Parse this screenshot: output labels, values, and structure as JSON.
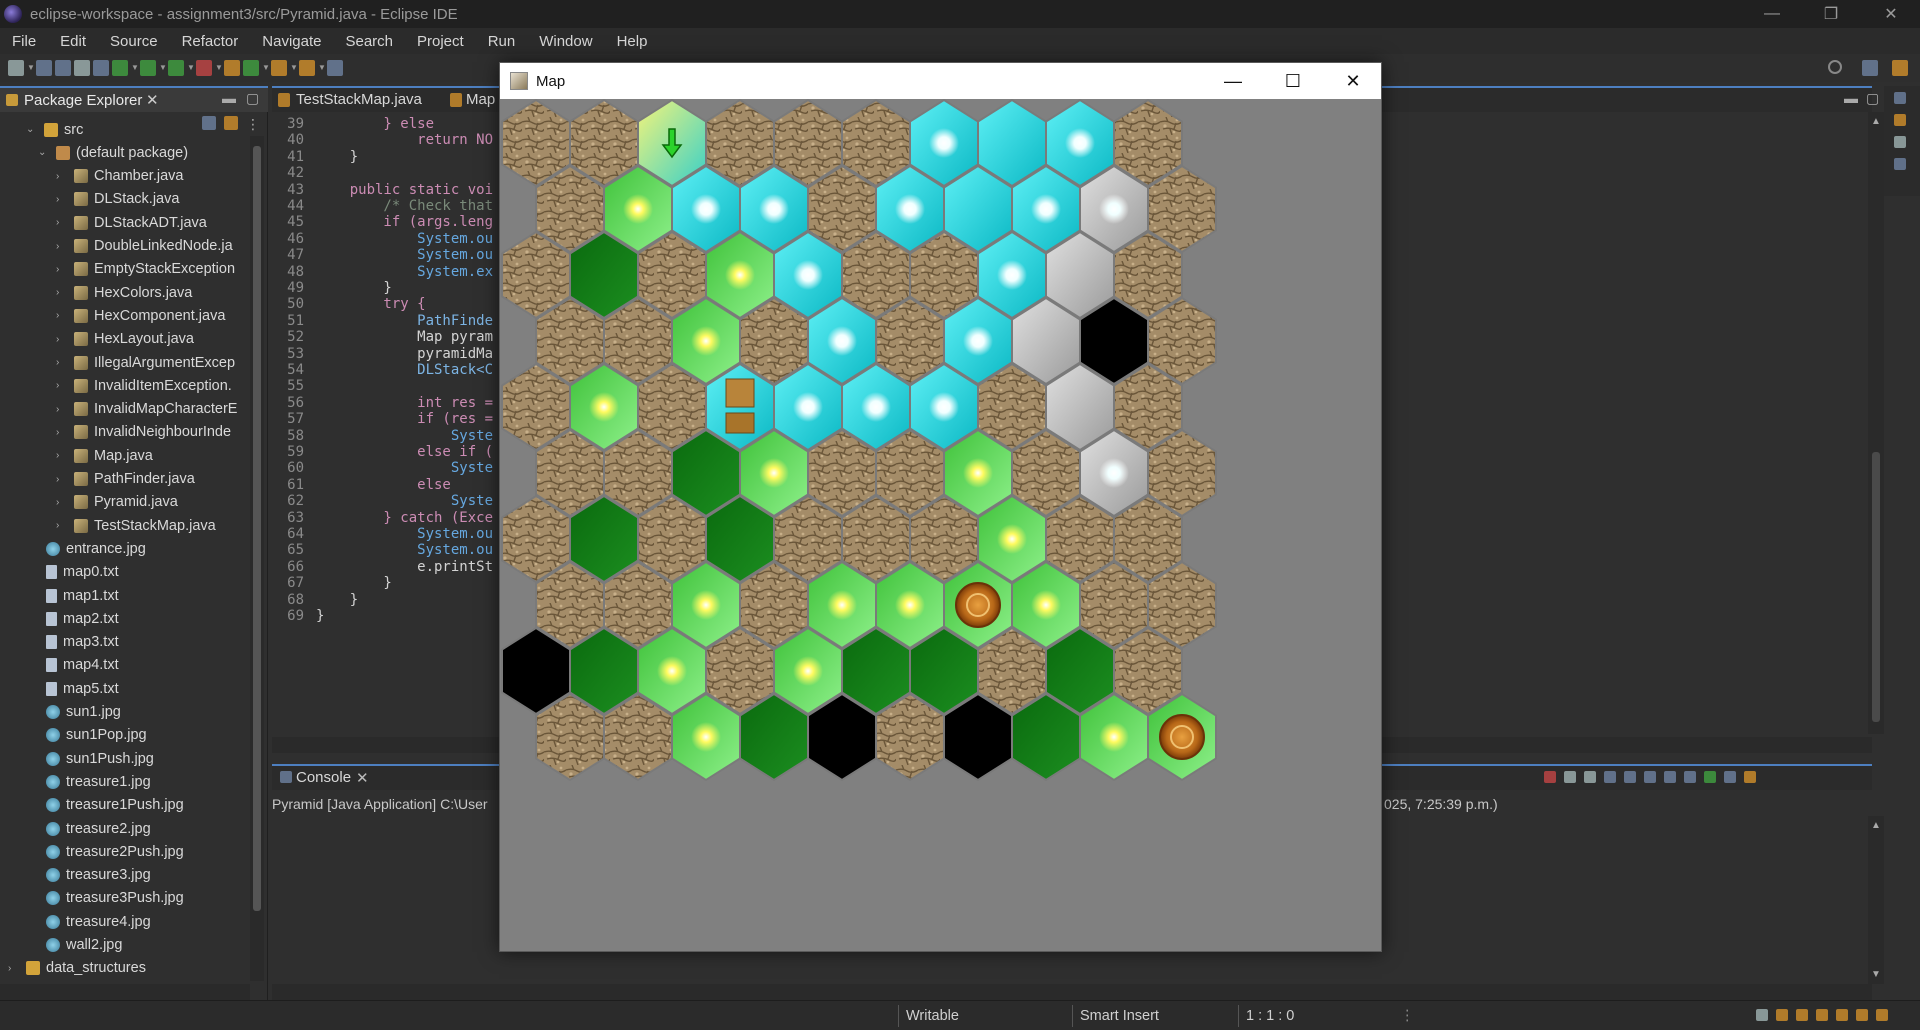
{
  "window": {
    "title": "eclipse-workspace - assignment3/src/Pyramid.java - Eclipse IDE",
    "controls": {
      "minimize": "—",
      "restore": "❐",
      "close": "✕"
    }
  },
  "menu": [
    "File",
    "Edit",
    "Source",
    "Refactor",
    "Navigate",
    "Search",
    "Project",
    "Run",
    "Window",
    "Help"
  ],
  "package_explorer": {
    "title": "Package Explorer",
    "close": "✕",
    "items": [
      {
        "label": "src",
        "icon": "source-folder-icon",
        "level": 1
      },
      {
        "label": "(default package)",
        "icon": "package-icon",
        "level": 2
      },
      {
        "label": "Chamber.java",
        "icon": "java-file-icon",
        "level": 3
      },
      {
        "label": "DLStack.java",
        "icon": "java-file-icon",
        "level": 3
      },
      {
        "label": "DLStackADT.java",
        "icon": "java-file-icon",
        "level": 3
      },
      {
        "label": "DoubleLinkedNode.ja",
        "icon": "java-file-icon",
        "level": 3
      },
      {
        "label": "EmptyStackException",
        "icon": "java-file-icon",
        "level": 3
      },
      {
        "label": "HexColors.java",
        "icon": "java-file-icon",
        "level": 3
      },
      {
        "label": "HexComponent.java",
        "icon": "java-file-icon",
        "level": 3
      },
      {
        "label": "HexLayout.java",
        "icon": "java-file-icon",
        "level": 3
      },
      {
        "label": "IllegalArgumentExcep",
        "icon": "java-file-icon",
        "level": 3
      },
      {
        "label": "InvalidItemException.",
        "icon": "java-file-icon",
        "level": 3
      },
      {
        "label": "InvalidMapCharacterE",
        "icon": "java-file-icon",
        "level": 3
      },
      {
        "label": "InvalidNeighbourInde",
        "icon": "java-file-icon",
        "level": 3
      },
      {
        "label": "Map.java",
        "icon": "java-file-icon",
        "level": 3
      },
      {
        "label": "PathFinder.java",
        "icon": "java-file-icon",
        "level": 3
      },
      {
        "label": "Pyramid.java",
        "icon": "java-file-icon",
        "level": 3
      },
      {
        "label": "TestStackMap.java",
        "icon": "java-file-icon",
        "level": 3
      },
      {
        "label": "entrance.jpg",
        "icon": "image-file-icon",
        "level": 2
      },
      {
        "label": "map0.txt",
        "icon": "text-file-icon",
        "level": 2
      },
      {
        "label": "map1.txt",
        "icon": "text-file-icon",
        "level": 2
      },
      {
        "label": "map2.txt",
        "icon": "text-file-icon",
        "level": 2
      },
      {
        "label": "map3.txt",
        "icon": "text-file-icon",
        "level": 2
      },
      {
        "label": "map4.txt",
        "icon": "text-file-icon",
        "level": 2
      },
      {
        "label": "map5.txt",
        "icon": "text-file-icon",
        "level": 2
      },
      {
        "label": "sun1.jpg",
        "icon": "image-file-icon",
        "level": 2
      },
      {
        "label": "sun1Pop.jpg",
        "icon": "image-file-icon",
        "level": 2
      },
      {
        "label": "sun1Push.jpg",
        "icon": "image-file-icon",
        "level": 2
      },
      {
        "label": "treasure1.jpg",
        "icon": "image-file-icon",
        "level": 2
      },
      {
        "label": "treasure1Push.jpg",
        "icon": "image-file-icon",
        "level": 2
      },
      {
        "label": "treasure2.jpg",
        "icon": "image-file-icon",
        "level": 2
      },
      {
        "label": "treasure2Push.jpg",
        "icon": "image-file-icon",
        "level": 2
      },
      {
        "label": "treasure3.jpg",
        "icon": "image-file-icon",
        "level": 2
      },
      {
        "label": "treasure3Push.jpg",
        "icon": "image-file-icon",
        "level": 2
      },
      {
        "label": "treasure4.jpg",
        "icon": "image-file-icon",
        "level": 2
      },
      {
        "label": "wall2.jpg",
        "icon": "image-file-icon",
        "level": 2
      },
      {
        "label": "data_structures",
        "icon": "project-icon",
        "level": 0
      }
    ]
  },
  "editor": {
    "tabs": [
      "TestStackMap.java",
      "Map"
    ],
    "lines": [
      {
        "n": "39",
        "code": "        } else"
      },
      {
        "n": "40",
        "code": "            return NO"
      },
      {
        "n": "41",
        "code": "    }"
      },
      {
        "n": "42",
        "code": ""
      },
      {
        "n": "43",
        "code": "    public static voi"
      },
      {
        "n": "44",
        "code": "        /* Check that"
      },
      {
        "n": "45",
        "code": "        if (args.leng"
      },
      {
        "n": "46",
        "code": "            System.ou"
      },
      {
        "n": "47",
        "code": "            System.ou"
      },
      {
        "n": "48",
        "code": "            System.ex"
      },
      {
        "n": "49",
        "code": "        }"
      },
      {
        "n": "50",
        "code": "        try {"
      },
      {
        "n": "51",
        "code": "            PathFinde"
      },
      {
        "n": "52",
        "code": "            Map pyram"
      },
      {
        "n": "53",
        "code": "            pyramidMa"
      },
      {
        "n": "54",
        "code": "            DLStack<C"
      },
      {
        "n": "55",
        "code": ""
      },
      {
        "n": "56",
        "code": "            int res ="
      },
      {
        "n": "57",
        "code": "            if (res ="
      },
      {
        "n": "58",
        "code": "                Syste"
      },
      {
        "n": "59",
        "code": "            else if ("
      },
      {
        "n": "60",
        "code": "                Syste"
      },
      {
        "n": "61",
        "code": "            else"
      },
      {
        "n": "62",
        "code": "                Syste"
      },
      {
        "n": "63",
        "code": "        } catch (Exce"
      },
      {
        "n": "64",
        "code": "            System.ou"
      },
      {
        "n": "65",
        "code": "            System.ou"
      },
      {
        "n": "66",
        "code": "            e.printSt"
      },
      {
        "n": "67",
        "code": "        }"
      },
      {
        "n": "68",
        "code": "    }"
      },
      {
        "n": "69",
        "code": "}"
      }
    ]
  },
  "console": {
    "title": "Console",
    "close": "✕",
    "launch_info_left": "Pyramid [Java Application] C:\\User",
    "launch_info_right": "025, 7:25:39 p.m.)"
  },
  "statusbar": {
    "writable": "Writable",
    "insert_mode": "Smart Insert",
    "position": "1 : 1 : 0"
  },
  "map_window": {
    "title": "Map",
    "controls": {
      "minimize": "—",
      "maximize": "☐",
      "close": "✕"
    },
    "colors": {
      "wall": "#a08a66",
      "cyan": "#19d3dc",
      "light_green": "#63dc5a",
      "dark_green": "#0f7e14",
      "black": "#000000",
      "gray": "#bdbdbd"
    },
    "legend_codes": "W=wall, C=cyan chamber, L=light-green chamber, D=dark-green chamber, B=black, G=gray, E=entrance, T=treasure, S=stack-treasure",
    "rows": [
      "WWEWWWCCCW",
      "WLCCWCCCGW",
      "WDWLCWWCGW",
      "WWLWCWCGBW",
      "WLWSCCCWGW",
      "WWDLWWLWGW",
      "WDWDWWWLWW",
      "WWLWLLTLWW",
      "BDLWLDDWDW",
      "WWLDBWBDLT"
    ],
    "glow_cells": [
      [
        0,
        6
      ],
      [
        0,
        8
      ],
      [
        1,
        1
      ],
      [
        1,
        2
      ],
      [
        1,
        3
      ],
      [
        1,
        5
      ],
      [
        1,
        7
      ],
      [
        1,
        8
      ],
      [
        2,
        3
      ],
      [
        2,
        4
      ],
      [
        2,
        7
      ],
      [
        3,
        2
      ],
      [
        3,
        4
      ],
      [
        3,
        6
      ],
      [
        4,
        1
      ],
      [
        4,
        4
      ],
      [
        4,
        5
      ],
      [
        4,
        6
      ],
      [
        5,
        3
      ],
      [
        5,
        6
      ],
      [
        5,
        8
      ],
      [
        6,
        7
      ],
      [
        7,
        2
      ],
      [
        7,
        4
      ],
      [
        7,
        5
      ],
      [
        7,
        7
      ],
      [
        8,
        2
      ],
      [
        8,
        4
      ],
      [
        9,
        2
      ],
      [
        9,
        8
      ]
    ]
  }
}
